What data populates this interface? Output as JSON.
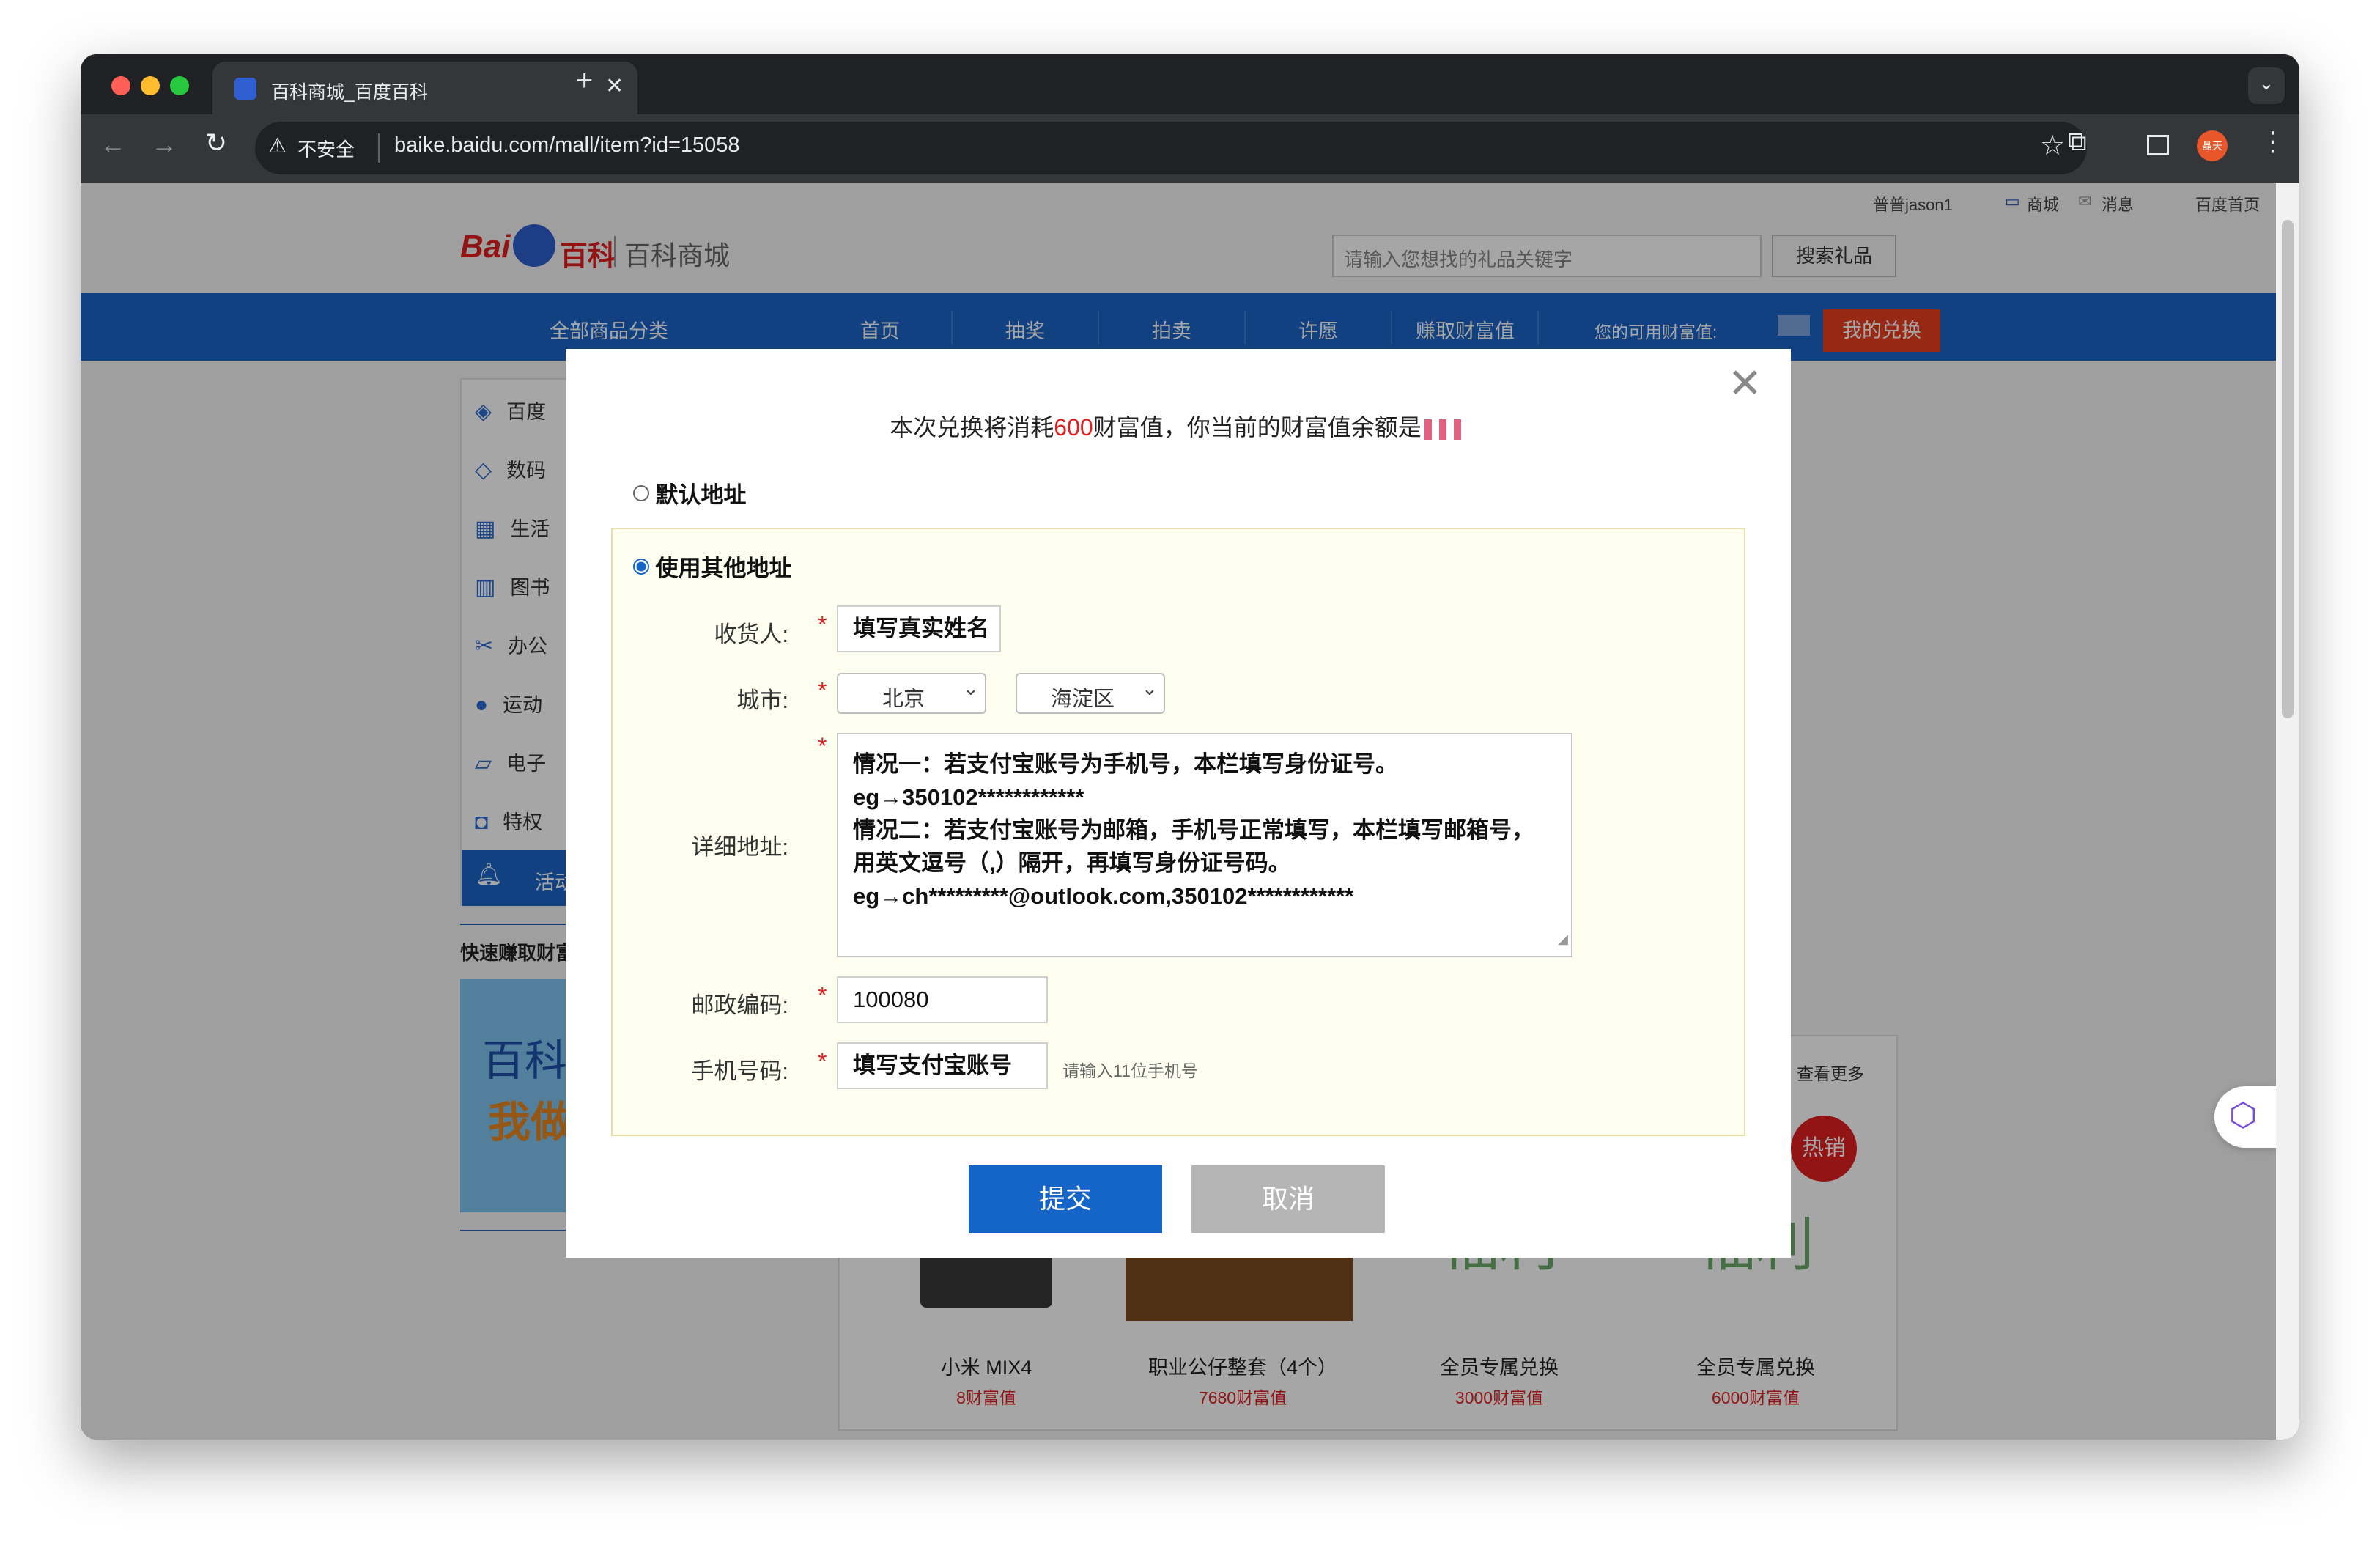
{
  "browser": {
    "tab_title": "百科商城_百度百科",
    "security_label": "不安全",
    "url": "baike.baidu.com/mall/item?id=15058",
    "profile_label": "晶天"
  },
  "page": {
    "top_links": {
      "user": "普普jason1",
      "mall": "商城",
      "messages": "消息",
      "home": "百度首页"
    },
    "logo_text": "百科商城",
    "search": {
      "placeholder": "请输入您想找的礼品关键字",
      "button": "搜索礼品"
    },
    "nav": {
      "category": "全部商品分类",
      "items": [
        "首页",
        "抽奖",
        "拍卖",
        "许愿",
        "赚取财富值"
      ],
      "wealth_label": "您的可用财富值:",
      "my_exchange": "我的兑换"
    },
    "sidebar": {
      "items": [
        "百度",
        "数码",
        "生活",
        "图书",
        "办公",
        "运动",
        "电子",
        "特权",
        "活动"
      ]
    },
    "quick_earn_title": "快速赚取财富",
    "banner": {
      "line1": "百科",
      "line2": "我做"
    },
    "see_more": "查看更多",
    "hot_badge": "热销",
    "products": [
      {
        "name": "小米 MIX4",
        "price": "8财富值"
      },
      {
        "name": "职业公仔整套（4个）",
        "price": "7680财富值"
      },
      {
        "name": "全员专属兑换",
        "price": "3000财富值"
      },
      {
        "name": "全员专属兑换",
        "price": "6000财富值"
      }
    ],
    "fuli_text": "福利"
  },
  "modal": {
    "msg_prefix": "本次兑换将消耗",
    "msg_cost": "600",
    "msg_suffix": "财富值，你当前的财富值余额是",
    "default_address_label": "默认地址",
    "other_address_label": "使用其他地址",
    "form": {
      "receiver_label": "收货人:",
      "receiver_value": "填写真实姓名",
      "city_label": "城市:",
      "city_value": "北京",
      "district_value": "海淀区",
      "address_label": "详细地址:",
      "address_lines": [
        "情况一：若支付宝账号为手机号，本栏填写身份证号。",
        "eg→350102************",
        "情况二：若支付宝账号为邮箱，手机号正常填写，本栏填写邮箱号，",
        "用英文逗号（,）隔开，再填写身份证号码。",
        "eg→ch*********@outlook.com,350102************"
      ],
      "zip_label": "邮政编码:",
      "zip_value": "100080",
      "phone_label": "手机号码:",
      "phone_value": "填写支付宝账号",
      "phone_hint": "请输入11位手机号"
    },
    "submit": "提交",
    "cancel": "取消"
  },
  "colors": {
    "nav_blue": "#1c64c8",
    "accent_red": "#e02020",
    "submit_blue": "#1565c8",
    "form_bg": "#fdfdf0"
  }
}
